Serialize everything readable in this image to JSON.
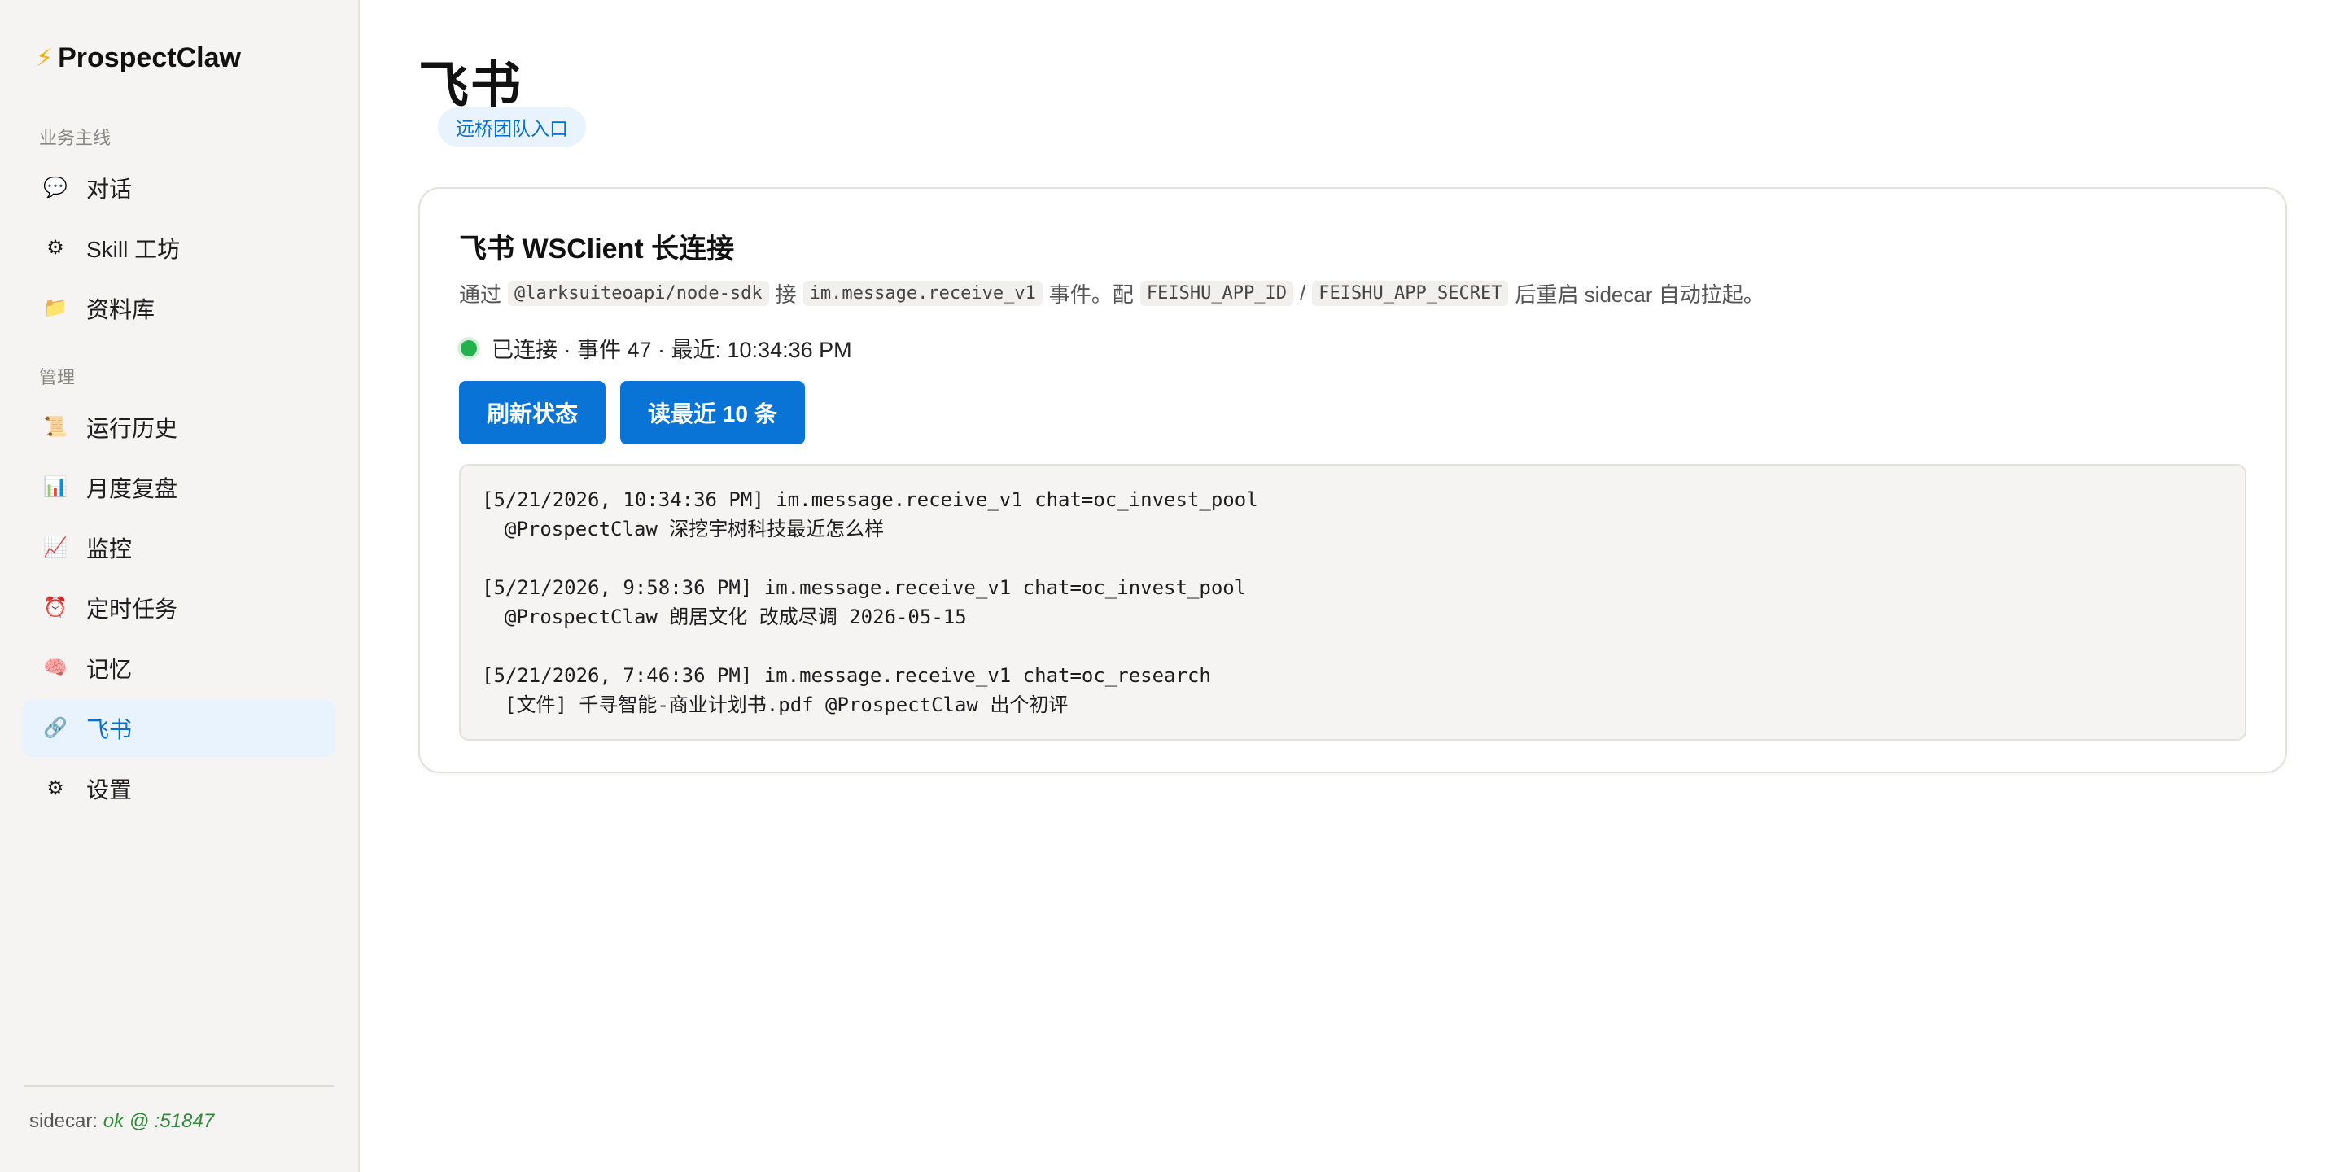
{
  "sidebar": {
    "brand": {
      "icon": "bolt-icon",
      "glyph": "⚡",
      "name": "ProspectClaw"
    },
    "sections": [
      {
        "label": "业务主线"
      },
      {
        "label": "管理"
      }
    ],
    "items": [
      {
        "icon": "speech-bubble-icon",
        "glyph": "💬",
        "label": "对话"
      },
      {
        "icon": "gear-icon",
        "glyph": "⚙",
        "label": "Skill 工坊"
      },
      {
        "icon": "folder-icon",
        "glyph": "📁",
        "label": "资料库"
      },
      {
        "icon": "scroll-icon",
        "glyph": "📜",
        "label": "运行历史"
      },
      {
        "icon": "bar-chart-icon",
        "glyph": "📊",
        "label": "月度复盘"
      },
      {
        "icon": "line-chart-icon",
        "glyph": "📈",
        "label": "监控"
      },
      {
        "icon": "alarm-clock-icon",
        "glyph": "⏰",
        "label": "定时任务"
      },
      {
        "icon": "brain-icon",
        "glyph": "🧠",
        "label": "记忆"
      },
      {
        "icon": "link-icon",
        "glyph": "🔗",
        "label": "飞书"
      },
      {
        "icon": "gear-icon",
        "glyph": "⚙",
        "label": "设置"
      }
    ],
    "active_item": "飞书",
    "sidecar": {
      "label": "sidecar:",
      "value": "ok @ :51847"
    }
  },
  "main": {
    "title": "飞书",
    "badge": "远桥团队入口",
    "card": {
      "title": "飞书 WSClient 长连接",
      "description": {
        "t1": "通过",
        "c1": "@larksuiteoapi/node-sdk",
        "t2": "接",
        "c2": "im.message.receive_v1",
        "t3": "事件。配",
        "c3": "FEISHU_APP_ID",
        "t4": "/",
        "c4": "FEISHU_APP_SECRET",
        "t5": "后重启 sidecar 自动拉起。"
      },
      "status": {
        "color": "#22b14c",
        "text": "已连接 · 事件 47 · 最近: 10:34:36 PM"
      },
      "buttons": {
        "refresh": "刷新状态",
        "read_recent": "读最近 10 条"
      },
      "log": [
        {
          "header": "[5/21/2026, 10:34:36 PM] im.message.receive_v1 chat=oc_invest_pool",
          "body": "@ProspectClaw 深挖宇树科技最近怎么样"
        },
        {
          "header": "[5/21/2026, 9:58:36 PM] im.message.receive_v1 chat=oc_invest_pool",
          "body": "@ProspectClaw 朗居文化 改成尽调 2026-05-15"
        },
        {
          "header": "[5/21/2026, 7:46:36 PM] im.message.receive_v1 chat=oc_research",
          "body": "[文件] 千寻智能-商业计划书.pdf @ProspectClaw 出个初评"
        }
      ]
    }
  },
  "colors": {
    "accent": "#0a73d6",
    "active_bg": "#e8f3fd",
    "status_ok": "#22b14c"
  }
}
